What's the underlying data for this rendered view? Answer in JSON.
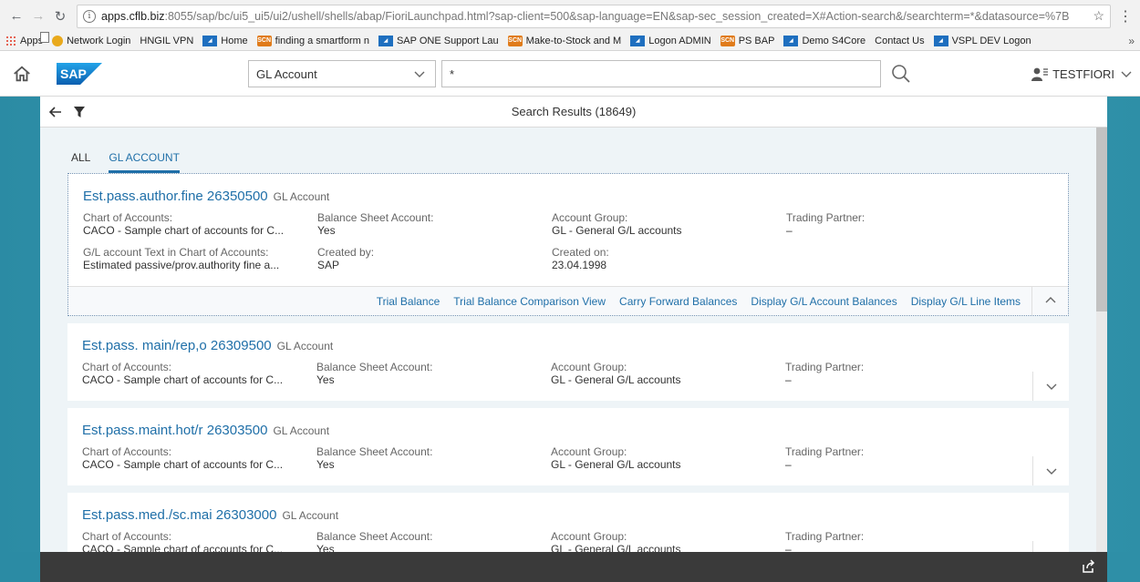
{
  "browser": {
    "url_host": "apps.cflb.biz",
    "url_path": ":8055/sap/bc/ui5_ui5/ui2/ushell/shells/abap/FioriLaunchpad.html?sap-client=500&sap-language=EN&sap-sec_session_created=X#Action-search&/searchterm=*&datasource=%7B",
    "bookmarks": [
      {
        "label": "Apps",
        "icon": "apps-grid-icon"
      },
      {
        "label": "Network Login",
        "icon": "network-icon"
      },
      {
        "label": "HNGIL VPN",
        "icon": "page-icon"
      },
      {
        "label": "Home",
        "icon": "sap-icon"
      },
      {
        "label": "finding a smartform n",
        "icon": "scn-icon"
      },
      {
        "label": "SAP ONE Support Lau",
        "icon": "sap-icon"
      },
      {
        "label": "Make-to-Stock and M",
        "icon": "scn-icon"
      },
      {
        "label": "Logon ADMIN",
        "icon": "sap-icon"
      },
      {
        "label": "PS BAP",
        "icon": "scn-icon"
      },
      {
        "label": "Demo S4Core",
        "icon": "sap-icon"
      },
      {
        "label": "Contact Us",
        "icon": "page-icon"
      },
      {
        "label": "VSPL DEV Logon",
        "icon": "sap-icon"
      }
    ],
    "more": "»"
  },
  "shell": {
    "logo": "SAP",
    "datasource": "GL Account",
    "search_value": "*",
    "user": "TESTFIORI"
  },
  "page": {
    "title": "Search Results (18649)",
    "tabs": [
      {
        "label": "ALL",
        "active": false
      },
      {
        "label": "GL ACCOUNT",
        "active": true
      }
    ]
  },
  "results": [
    {
      "title": "Est.pass.author.fine 26350500",
      "type": "GL Account",
      "expanded": true,
      "attrs": [
        {
          "label": "Chart of Accounts:",
          "value": "CACO - Sample chart of accounts for C..."
        },
        {
          "label": "Balance Sheet Account:",
          "value": "Yes"
        },
        {
          "label": "Account Group:",
          "value": "GL - General G/L accounts"
        },
        {
          "label": "Trading Partner:",
          "value": "–"
        },
        {
          "label": "G/L account Text in Chart of Accounts:",
          "value": "Estimated passive/prov.authority fine a..."
        },
        {
          "label": "Created by:",
          "value": "SAP"
        },
        {
          "label": "Created on:",
          "value": "23.04.1998"
        }
      ],
      "actions": [
        "Trial Balance",
        "Trial Balance Comparison View",
        "Carry Forward Balances",
        "Display G/L Account Balances",
        "Display G/L Line Items"
      ]
    },
    {
      "title": "Est.pass. main/rep,o 26309500",
      "type": "GL Account",
      "expanded": false,
      "attrs": [
        {
          "label": "Chart of Accounts:",
          "value": "CACO - Sample chart of accounts for C..."
        },
        {
          "label": "Balance Sheet Account:",
          "value": "Yes"
        },
        {
          "label": "Account Group:",
          "value": "GL - General G/L accounts"
        },
        {
          "label": "Trading Partner:",
          "value": "–"
        }
      ]
    },
    {
      "title": "Est.pass.maint.hot/r 26303500",
      "type": "GL Account",
      "expanded": false,
      "attrs": [
        {
          "label": "Chart of Accounts:",
          "value": "CACO - Sample chart of accounts for C..."
        },
        {
          "label": "Balance Sheet Account:",
          "value": "Yes"
        },
        {
          "label": "Account Group:",
          "value": "GL - General G/L accounts"
        },
        {
          "label": "Trading Partner:",
          "value": "–"
        }
      ]
    },
    {
      "title": "Est.pass.med./sc.mai 26303000",
      "type": "GL Account",
      "expanded": false,
      "attrs": [
        {
          "label": "Chart of Accounts:",
          "value": "CACO - Sample chart of accounts for C..."
        },
        {
          "label": "Balance Sheet Account:",
          "value": "Yes"
        },
        {
          "label": "Account Group:",
          "value": "GL - General G/L accounts"
        },
        {
          "label": "Trading Partner:",
          "value": "–"
        }
      ]
    }
  ],
  "colors": {
    "link": "#1f6fa8",
    "canvas": "#3da1b6",
    "footer": "#3a3a3a"
  }
}
